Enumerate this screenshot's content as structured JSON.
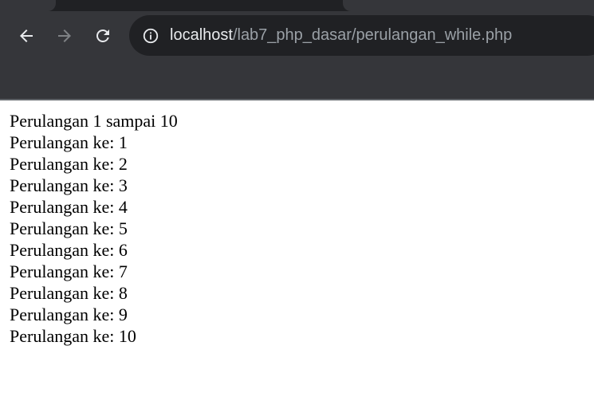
{
  "browser": {
    "url_host": "localhost",
    "url_path": "/lab7_php_dasar/perulangan_while.php",
    "icons": {
      "back": "back-arrow-icon",
      "forward": "forward-arrow-icon",
      "reload": "reload-icon",
      "site_info": "site-info-icon"
    }
  },
  "page": {
    "heading": "Perulangan 1 sampai 10",
    "lines": [
      "Perulangan ke: 1",
      "Perulangan ke: 2",
      "Perulangan ke: 3",
      "Perulangan ke: 4",
      "Perulangan ke: 5",
      "Perulangan ke: 6",
      "Perulangan ke: 7",
      "Perulangan ke: 8",
      "Perulangan ke: 9",
      "Perulangan ke: 10"
    ]
  }
}
